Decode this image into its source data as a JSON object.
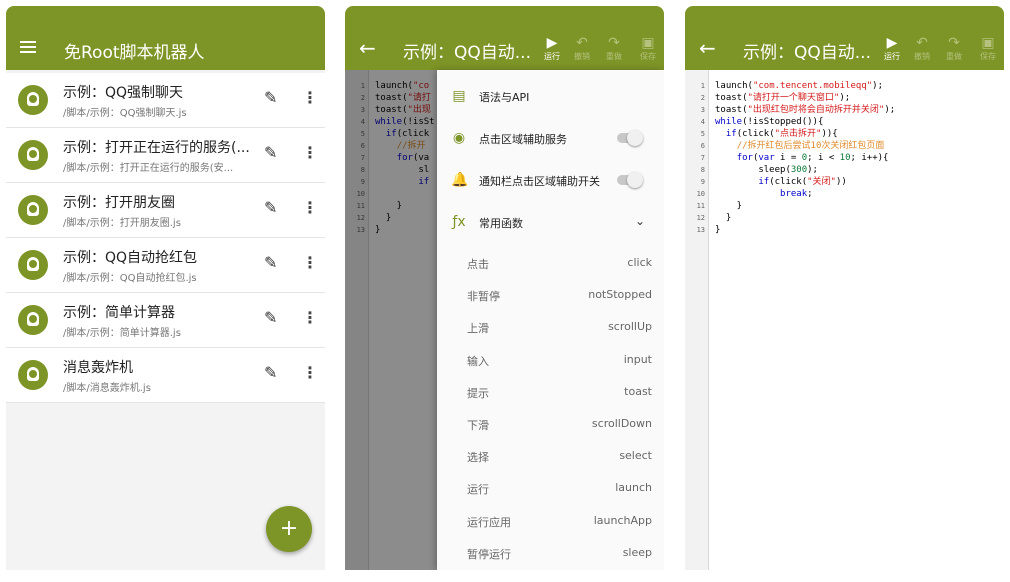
{
  "panel1": {
    "title": "免Root脚本机器人",
    "items": [
      {
        "name": "示例：QQ强制聊天",
        "path": "/脚本/示例：QQ强制聊天.js"
      },
      {
        "name": "示例：打开正在运行的服务(...",
        "path": "/脚本/示例：打开正在运行的服务(安..."
      },
      {
        "name": "示例：打开朋友圈",
        "path": "/脚本/示例：打开朋友圈.js"
      },
      {
        "name": "示例：QQ自动抢红包",
        "path": "/脚本/示例：QQ自动抢红包.js"
      },
      {
        "name": "示例：简单计算器",
        "path": "/脚本/示例：简单计算器.js"
      },
      {
        "name": "消息轰炸机",
        "path": "/脚本/消息轰炸机.js"
      }
    ],
    "fab_icon": "+"
  },
  "editor": {
    "title": "示例：QQ自动...",
    "toolbar": [
      {
        "icon": "play-icon",
        "glyph": "▶",
        "label": "运行",
        "enabled": true
      },
      {
        "icon": "undo-icon",
        "glyph": "↶",
        "label": "撤销",
        "enabled": false
      },
      {
        "icon": "redo-icon",
        "glyph": "↷",
        "label": "重做",
        "enabled": false
      },
      {
        "icon": "save-icon",
        "glyph": "▣",
        "label": "保存",
        "enabled": false
      }
    ],
    "line_numbers": [
      "1",
      "2",
      "3",
      "4",
      "5",
      "6",
      "7",
      "8",
      "9",
      "10",
      "11",
      "12",
      "13"
    ],
    "code": [
      "launch(\"com.tencent.mobileqq\");",
      "toast(\"请打开一个聊天窗口\");",
      "toast(\"出现红包时将会自动拆开并关闭\");",
      "while(!isStopped()){",
      "  if(click(\"点击拆开\")){",
      "    //拆开红包后尝试10次关闭红包页面",
      "    for(var i = 0; i < 10; i++){",
      "        sleep(300);",
      "        if(click(\"关闭\"))",
      "            break;",
      "    }",
      "  }",
      "}"
    ],
    "code_partial": [
      "launch(\"co",
      "toast(\"请打",
      "toast(\"出现",
      "while(!isSt",
      "  if(click",
      "    //拆开",
      "    for(va",
      "        sl",
      "        if",
      "",
      "    }",
      "  }",
      "}"
    ]
  },
  "drawer": {
    "items": [
      {
        "icon": "api-doc-icon",
        "glyph": "▤",
        "label": "语法与API",
        "control": "none"
      },
      {
        "icon": "accessibility-icon",
        "glyph": "◉",
        "label": "点击区域辅助服务",
        "control": "toggle",
        "state": "off"
      },
      {
        "icon": "notification-bell-icon",
        "glyph": "🔔",
        "label": "通知栏点击区域辅助开关",
        "control": "toggle",
        "state": "off"
      },
      {
        "icon": "function-icon",
        "glyph": "ƒx",
        "label": "常用函数",
        "control": "expand"
      }
    ],
    "functions": [
      {
        "cn": "点击",
        "en": "click"
      },
      {
        "cn": "非暂停",
        "en": "notStopped"
      },
      {
        "cn": "上滑",
        "en": "scrollUp"
      },
      {
        "cn": "输入",
        "en": "input"
      },
      {
        "cn": "提示",
        "en": "toast"
      },
      {
        "cn": "下滑",
        "en": "scrollDown"
      },
      {
        "cn": "选择",
        "en": "select"
      },
      {
        "cn": "运行",
        "en": "launch"
      },
      {
        "cn": "运行应用",
        "en": "launchApp"
      },
      {
        "cn": "暂停运行",
        "en": "sleep"
      }
    ]
  },
  "colors": {
    "primary": "#7d9426",
    "toolbar_disabled": "#b4c27d",
    "string": "#d41a1a",
    "comment": "#e08b2c",
    "keyword": "#0000cc"
  }
}
